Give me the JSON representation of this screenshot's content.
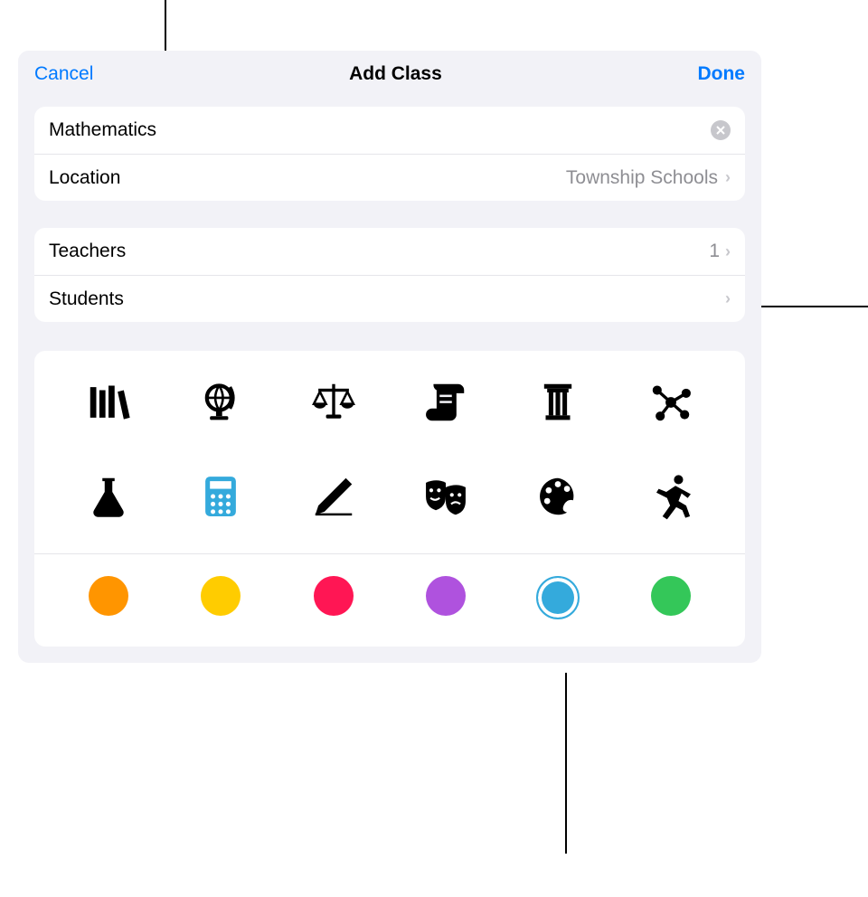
{
  "header": {
    "cancel": "Cancel",
    "title": "Add Class",
    "done": "Done"
  },
  "form": {
    "class_name": "Mathematics",
    "location_label": "Location",
    "location_value": "Township Schools"
  },
  "members": {
    "teachers_label": "Teachers",
    "teachers_count": "1",
    "students_label": "Students"
  },
  "icons": [
    {
      "name": "books-icon",
      "selected": false
    },
    {
      "name": "globe-icon",
      "selected": false
    },
    {
      "name": "scales-icon",
      "selected": false
    },
    {
      "name": "scroll-icon",
      "selected": false
    },
    {
      "name": "column-icon",
      "selected": false
    },
    {
      "name": "molecule-icon",
      "selected": false
    },
    {
      "name": "flask-icon",
      "selected": false
    },
    {
      "name": "calculator-icon",
      "selected": true
    },
    {
      "name": "pencil-icon",
      "selected": false
    },
    {
      "name": "masks-icon",
      "selected": false
    },
    {
      "name": "palette-icon",
      "selected": false
    },
    {
      "name": "runner-icon",
      "selected": false
    }
  ],
  "colors": [
    {
      "name": "orange",
      "hex": "#ff9500",
      "selected": false
    },
    {
      "name": "yellow",
      "hex": "#ffcc00",
      "selected": false
    },
    {
      "name": "pink",
      "hex": "#ff1654",
      "selected": false
    },
    {
      "name": "purple",
      "hex": "#af52de",
      "selected": false
    },
    {
      "name": "blue",
      "hex": "#34aadc",
      "selected": true
    },
    {
      "name": "green",
      "hex": "#34c759",
      "selected": false
    }
  ]
}
